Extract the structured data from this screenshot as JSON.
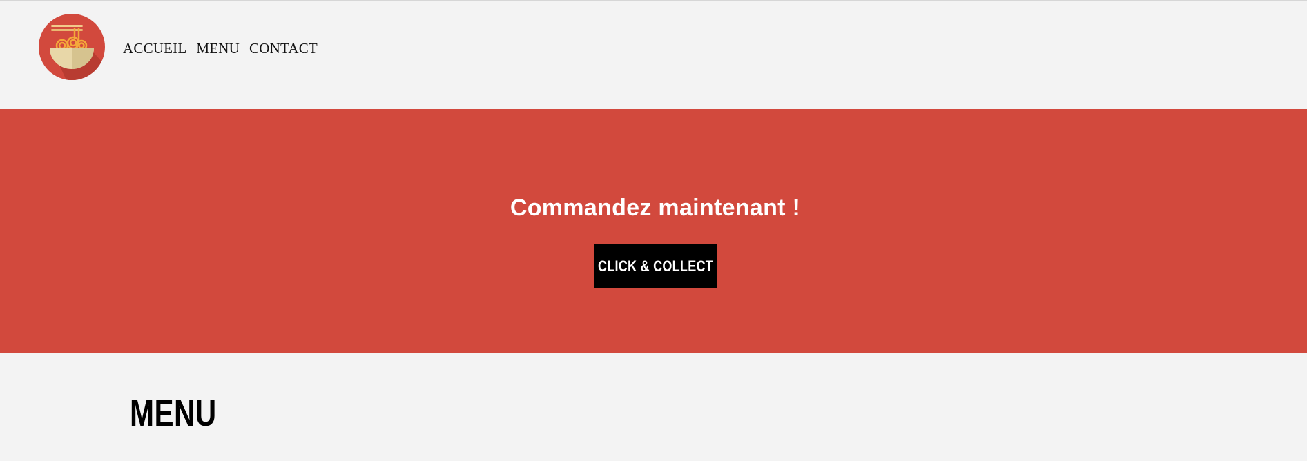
{
  "nav": {
    "items": [
      {
        "label": "ACCUEIL"
      },
      {
        "label": "MENU"
      },
      {
        "label": "CONTACT"
      }
    ]
  },
  "logo": {
    "icon": "noodle-bowl-icon"
  },
  "hero": {
    "title": "Commandez maintenant !",
    "button_label": "CLICK & COLLECT"
  },
  "menu": {
    "title": "MENU"
  },
  "colors": {
    "accent": "#d2493d",
    "background": "#f3f3f3",
    "button": "#000000"
  }
}
